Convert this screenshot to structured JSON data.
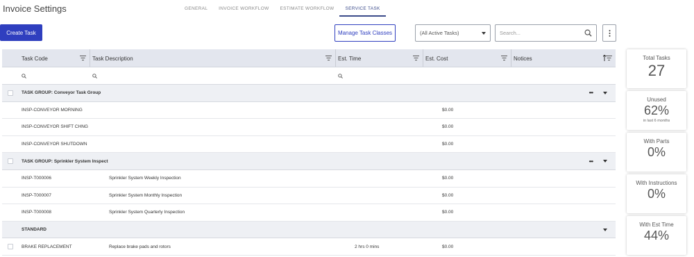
{
  "header": {
    "title": "Invoice Settings",
    "tabs": [
      "GENERAL",
      "INVOICE WORKFLOW",
      "ESTIMATE WORKFLOW",
      "SERVICE TASK"
    ],
    "active_tab": "SERVICE TASK"
  },
  "toolbar": {
    "create_label": "Create Task",
    "manage_label": "Manage Task Classes",
    "filter_value": "(All Active Tasks)",
    "search_placeholder": "Search..."
  },
  "table": {
    "columns": [
      "Task Code",
      "Task Description",
      "Est. Time",
      "Est. Cost",
      "Notices"
    ],
    "groups": [
      {
        "title": "TASK GROUP: Conveyor Task Group"
      },
      {
        "title": "TASK GROUP: Sprinkler System Inspect"
      },
      {
        "title": "STANDARD"
      }
    ],
    "rows": [
      {
        "code": "INSP-CONVEYOR MORNING",
        "desc": "",
        "time": "",
        "cost": "$0.00"
      },
      {
        "code": "INSP-CONVEYOR SHIFT CHNG",
        "desc": "",
        "time": "",
        "cost": "$0.00"
      },
      {
        "code": "INSP-CONVEYOR SHUTDOWN",
        "desc": "",
        "time": "",
        "cost": "$0.00"
      },
      {
        "code": "INSP-T000006",
        "desc": "Sprinkler System Weekly Inspection",
        "time": "",
        "cost": "$0.00"
      },
      {
        "code": "INSP-T000007",
        "desc": "Sprinkler System Monthly Inspection",
        "time": "",
        "cost": "$0.00"
      },
      {
        "code": "INSP-T000008",
        "desc": "Sprinkler System Quarterly Inspection",
        "time": "",
        "cost": "$0.00"
      },
      {
        "code": "BRAKE REPLACEMENT",
        "desc": "Replace brake pads and rotors",
        "time": "2 hrs 0 mins",
        "cost": "$0.00"
      }
    ]
  },
  "stats": [
    {
      "label": "Total Tasks",
      "value": "27",
      "sub": ""
    },
    {
      "label": "Unused",
      "value": "62%",
      "sub": "in last 6 months"
    },
    {
      "label": "With Parts",
      "value": "0%",
      "sub": ""
    },
    {
      "label": "With Instructions",
      "value": "0%",
      "sub": ""
    },
    {
      "label": "With Est Time",
      "value": "44%",
      "sub": ""
    }
  ],
  "colors": {
    "accent": "#2f3fbf",
    "header_bg": "#e3e6ee",
    "group_bg": "#eef0f4"
  }
}
